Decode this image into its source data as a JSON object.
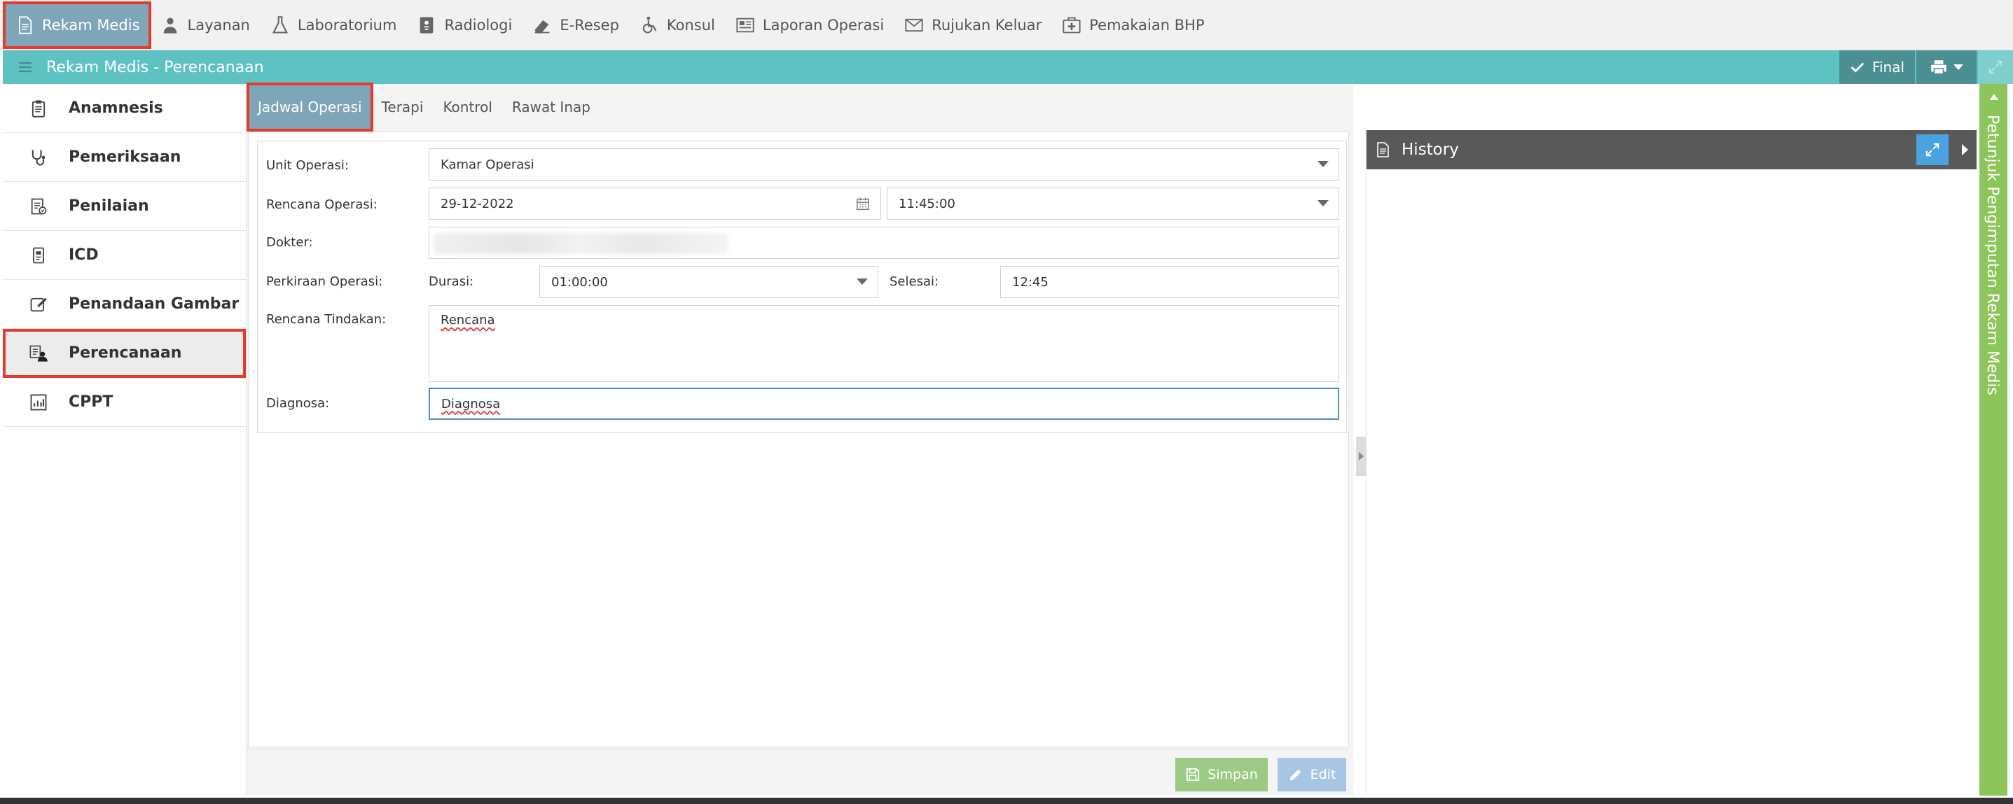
{
  "toolbar": {
    "items": [
      {
        "label": "Rekam Medis",
        "icon": "document-icon"
      },
      {
        "label": "Layanan",
        "icon": "doctor-icon"
      },
      {
        "label": "Laboratorium",
        "icon": "flask-icon"
      },
      {
        "label": "Radiologi",
        "icon": "xray-icon"
      },
      {
        "label": "E-Resep",
        "icon": "eraser-icon"
      },
      {
        "label": "Konsul",
        "icon": "wheelchair-icon"
      },
      {
        "label": "Laporan Operasi",
        "icon": "newspaper-icon"
      },
      {
        "label": "Rujukan Keluar",
        "icon": "envelope-icon"
      },
      {
        "label": "Pemakaian BHP",
        "icon": "medkit-icon"
      }
    ]
  },
  "titlebar": {
    "title": "Rekam Medis - Perencanaan",
    "final_label": "Final"
  },
  "sidebar": {
    "items": [
      {
        "label": "Anamnesis",
        "icon": "clipboard-icon"
      },
      {
        "label": "Pemeriksaan",
        "icon": "stethoscope-icon"
      },
      {
        "label": "Penilaian",
        "icon": "assessment-icon"
      },
      {
        "label": "ICD",
        "icon": "id-card-icon"
      },
      {
        "label": "Penandaan Gambar",
        "icon": "edit-icon"
      },
      {
        "label": "Perencanaan",
        "icon": "planning-icon"
      },
      {
        "label": "CPPT",
        "icon": "chart-icon"
      }
    ]
  },
  "tabs": [
    "Jadwal Operasi",
    "Terapi",
    "Kontrol",
    "Rawat Inap"
  ],
  "form": {
    "unit_label": "Unit Operasi:",
    "unit_value": "Kamar Operasi",
    "rencana_label": "Rencana Operasi:",
    "rencana_date": "29-12-2022",
    "rencana_time": "11:45:00",
    "dokter_label": "Dokter:",
    "perkiraan_label": "Perkiraan Operasi:",
    "durasi_label": "Durasi:",
    "durasi_value": "01:00:00",
    "selesai_label": "Selesai:",
    "selesai_value": "12:45",
    "tindakan_label": "Rencana Tindakan:",
    "tindakan_value": "Rencana",
    "diagnosa_label": "Diagnosa:",
    "diagnosa_value": "Diagnosa"
  },
  "buttons": {
    "simpan": "Simpan",
    "edit": "Edit"
  },
  "history": {
    "title": "History"
  },
  "guide": {
    "label": "Petunjuk Pengimputan Rekam Medis"
  },
  "colors": {
    "titlebar": "#5ec2c2",
    "active_tab": "#7fa6b8",
    "highlight": "#e53a2c",
    "guide": "#8cc55a",
    "simpan": "#9cc983",
    "edit": "#a8c6e3"
  }
}
